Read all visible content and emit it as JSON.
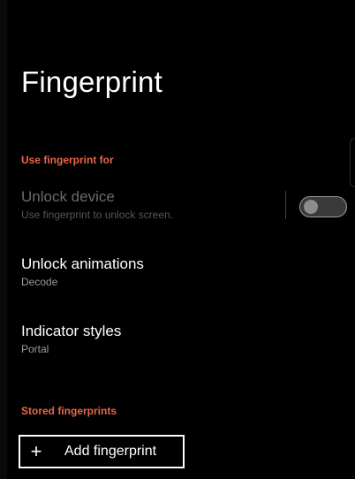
{
  "page": {
    "title": "Fingerprint"
  },
  "sections": {
    "use_for": "Use fingerprint for",
    "stored": "Stored fingerprints"
  },
  "prefs": {
    "unlock_device": {
      "title": "Unlock device",
      "summary": "Use fingerprint to unlock screen.",
      "enabled": false,
      "switch_on": false
    },
    "unlock_animations": {
      "title": "Unlock animations",
      "summary": "Decode"
    },
    "indicator_styles": {
      "title": "Indicator styles",
      "summary": "Portal"
    }
  },
  "add_button": {
    "icon": "plus-icon",
    "label": "Add fingerprint"
  },
  "colors": {
    "background": "#000000",
    "accent": "#e8674a",
    "text_primary": "#ffffff",
    "text_secondary": "#9a9a9a",
    "text_disabled": "#6b6b6b"
  }
}
